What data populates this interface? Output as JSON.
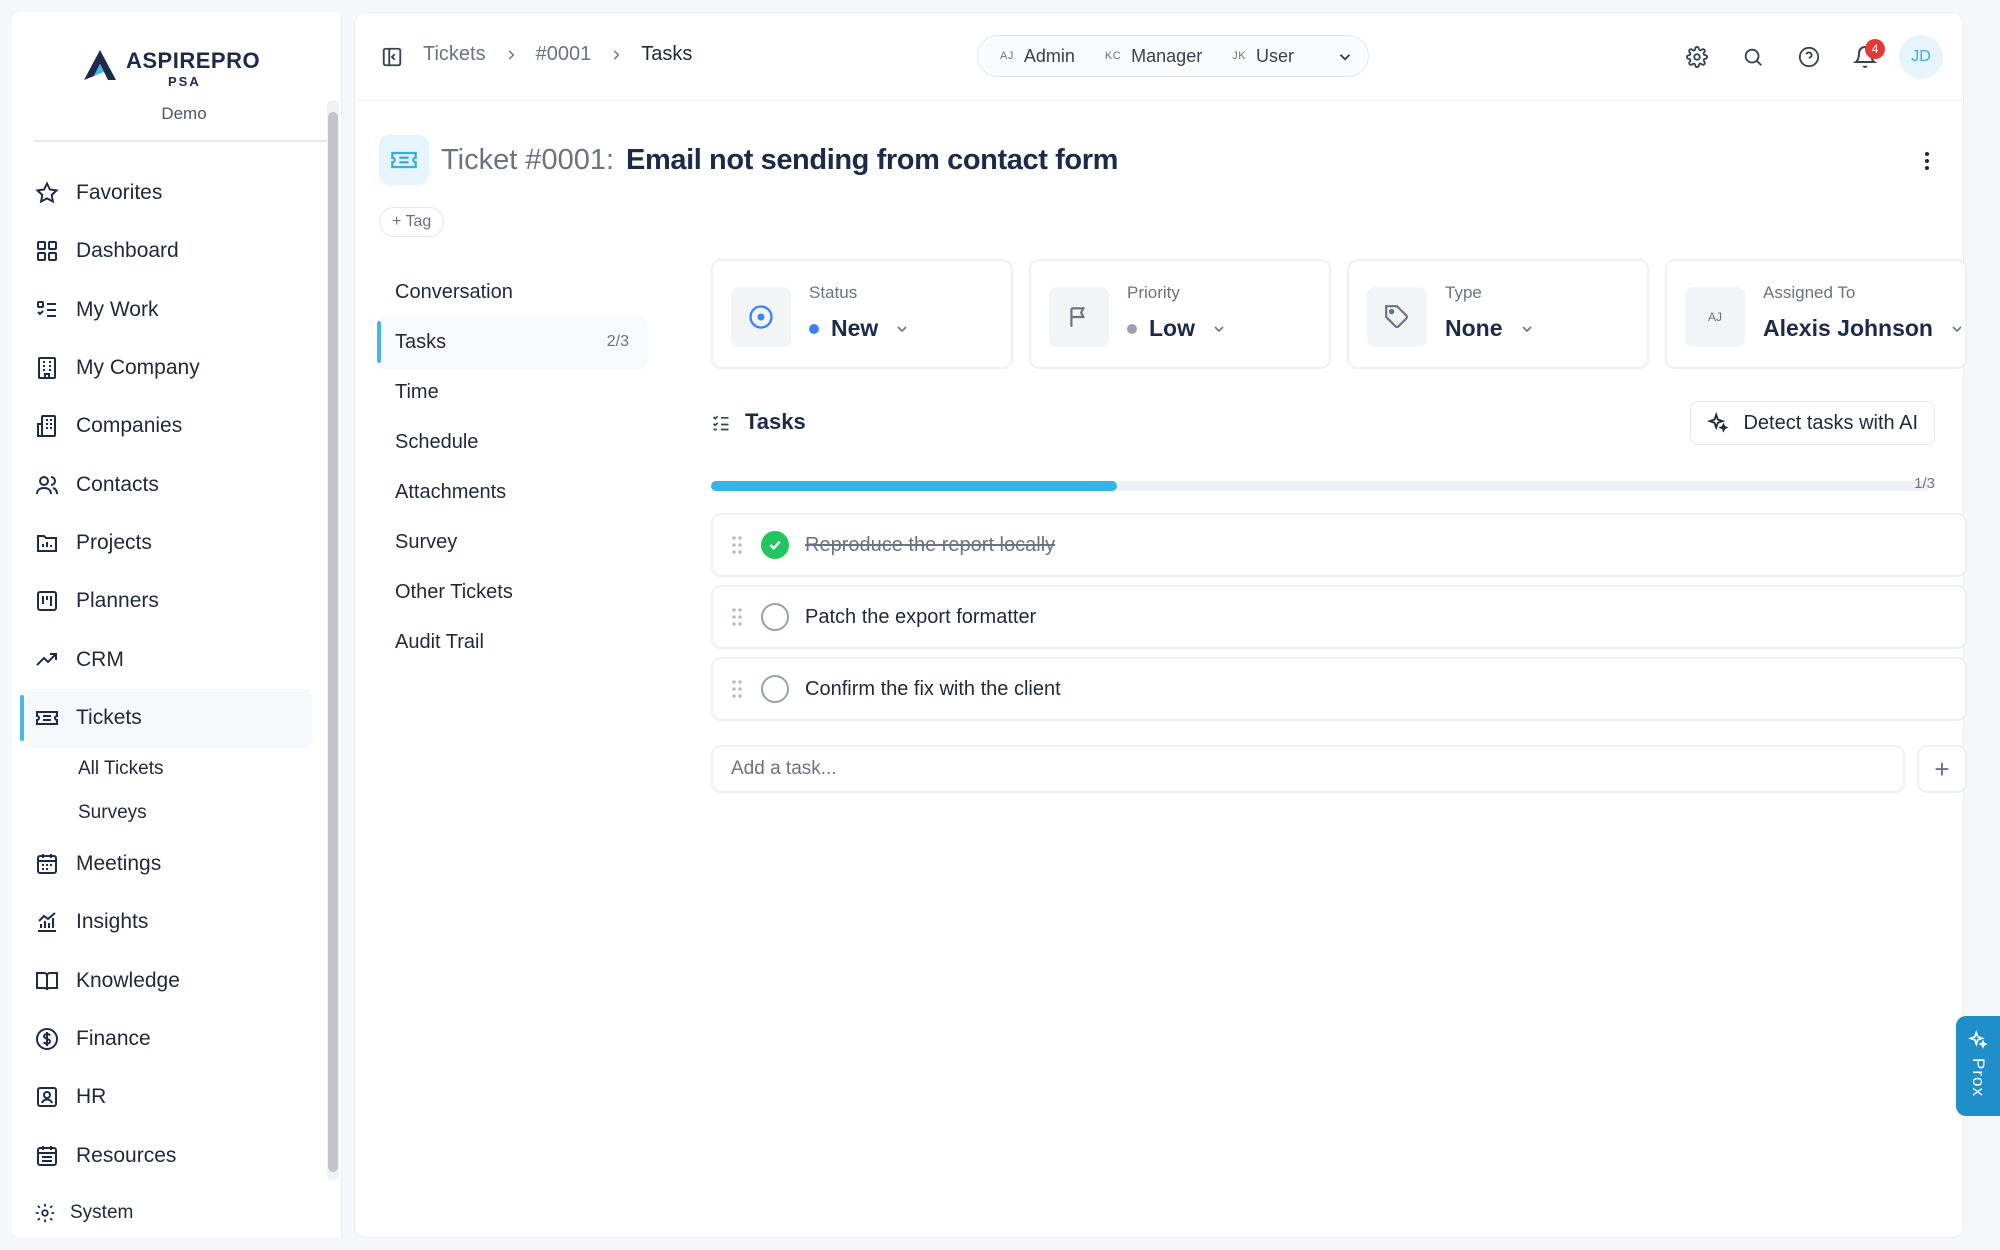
{
  "brand": {
    "name": "ASPIREPRO",
    "sub": "PSA",
    "workspace": "Demo"
  },
  "sidebar": {
    "items": [
      {
        "label": "Favorites",
        "icon": "star-icon"
      },
      {
        "label": "Dashboard",
        "icon": "grid-icon"
      },
      {
        "label": "My Work",
        "icon": "checklist-icon"
      },
      {
        "label": "My Company",
        "icon": "building-icon"
      },
      {
        "label": "Companies",
        "icon": "buildings-icon"
      },
      {
        "label": "Contacts",
        "icon": "users-icon"
      },
      {
        "label": "Projects",
        "icon": "folder-chart-icon"
      },
      {
        "label": "Planners",
        "icon": "kanban-icon"
      },
      {
        "label": "CRM",
        "icon": "trend-icon"
      },
      {
        "label": "Tickets",
        "icon": "ticket-icon"
      }
    ],
    "sub_items": [
      {
        "label": "All Tickets"
      },
      {
        "label": "Surveys"
      }
    ],
    "items_after": [
      {
        "label": "Meetings",
        "icon": "calendar-icon"
      },
      {
        "label": "Insights",
        "icon": "chart-icon"
      },
      {
        "label": "Knowledge",
        "icon": "book-icon"
      },
      {
        "label": "Finance",
        "icon": "dollar-icon"
      },
      {
        "label": "HR",
        "icon": "badge-icon"
      },
      {
        "label": "Resources",
        "icon": "calendar-list-icon"
      }
    ],
    "system": "System"
  },
  "breadcrumb": {
    "items": [
      "Tickets",
      "#0001",
      "Tasks"
    ]
  },
  "roles": [
    {
      "initials": "AJ",
      "label": "Admin"
    },
    {
      "initials": "KC",
      "label": "Manager"
    },
    {
      "initials": "JK",
      "label": "User"
    }
  ],
  "notifications": {
    "count": "4"
  },
  "user": {
    "initials": "JD"
  },
  "ticket": {
    "number": "Ticket #0001:",
    "title": "Email not sending from contact form",
    "tag_label": "+ Tag"
  },
  "subnav": {
    "items": [
      "Conversation",
      "Tasks",
      "Time",
      "Schedule",
      "Attachments",
      "Survey",
      "Other Tickets",
      "Audit Trail"
    ],
    "tasks_count": "2/3"
  },
  "fields": {
    "status": {
      "label": "Status",
      "value": "New",
      "color": "#3b82f6"
    },
    "priority": {
      "label": "Priority",
      "value": "Low",
      "color": "#9ca3af"
    },
    "type": {
      "label": "Type",
      "value": "None"
    },
    "assigned": {
      "label": "Assigned To",
      "value": "Alexis Johnson",
      "initials": "AJ"
    }
  },
  "tasks": {
    "title": "Tasks",
    "detect_label": "Detect tasks with AI",
    "progress": 0.333,
    "progress_label": "1/3",
    "items": [
      {
        "label": "Reproduce the report locally",
        "done": true
      },
      {
        "label": "Patch the export formatter",
        "done": false
      },
      {
        "label": "Confirm the fix with the client",
        "done": false
      }
    ],
    "add_placeholder": "Add a task...",
    "add_button": "+"
  },
  "assistant": {
    "label": "Prox"
  },
  "colors": {
    "accent": "#44b9e6",
    "progress": "#33b5e8",
    "success": "#22c55e",
    "danger": "#e53935",
    "assistant": "#1f8fca"
  }
}
